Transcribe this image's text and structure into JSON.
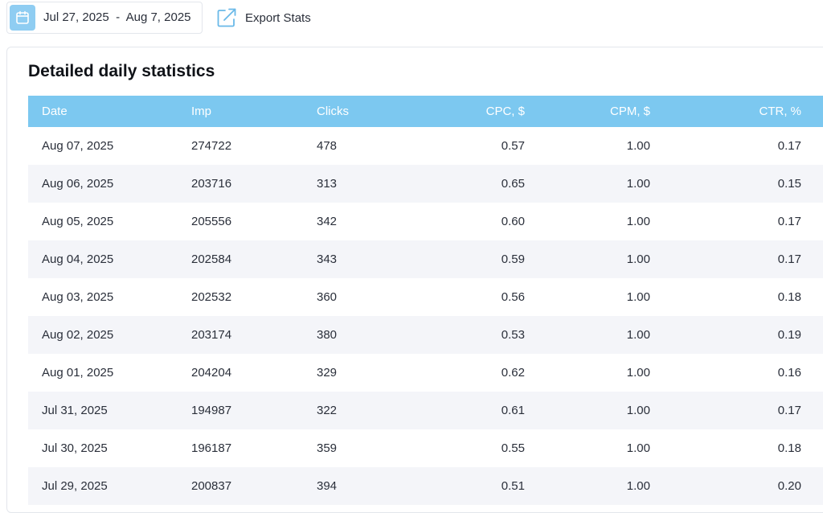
{
  "toolbar": {
    "date_start": "Jul 27, 2025",
    "date_sep": "-",
    "date_end": "Aug 7, 2025",
    "export_label": "Export Stats",
    "calendar_icon": "calendar-icon",
    "export_icon": "external-link-icon",
    "accent": "#8fcdf2"
  },
  "stats": {
    "title": "Detailed daily statistics",
    "header_color": "#7cc8f0",
    "columns": [
      "Date",
      "Imp",
      "Clicks",
      "CPC, $",
      "CPM, $",
      "CTR, %"
    ],
    "rows": [
      [
        "Aug 07, 2025",
        "274722",
        "478",
        "0.57",
        "1.00",
        "0.17"
      ],
      [
        "Aug 06, 2025",
        "203716",
        "313",
        "0.65",
        "1.00",
        "0.15"
      ],
      [
        "Aug 05, 2025",
        "205556",
        "342",
        "0.60",
        "1.00",
        "0.17"
      ],
      [
        "Aug 04, 2025",
        "202584",
        "343",
        "0.59",
        "1.00",
        "0.17"
      ],
      [
        "Aug 03, 2025",
        "202532",
        "360",
        "0.56",
        "1.00",
        "0.18"
      ],
      [
        "Aug 02, 2025",
        "203174",
        "380",
        "0.53",
        "1.00",
        "0.19"
      ],
      [
        "Aug 01, 2025",
        "204204",
        "329",
        "0.62",
        "1.00",
        "0.16"
      ],
      [
        "Jul 31, 2025",
        "194987",
        "322",
        "0.61",
        "1.00",
        "0.17"
      ],
      [
        "Jul 30, 2025",
        "196187",
        "359",
        "0.55",
        "1.00",
        "0.18"
      ],
      [
        "Jul 29, 2025",
        "200837",
        "394",
        "0.51",
        "1.00",
        "0.20"
      ]
    ]
  }
}
